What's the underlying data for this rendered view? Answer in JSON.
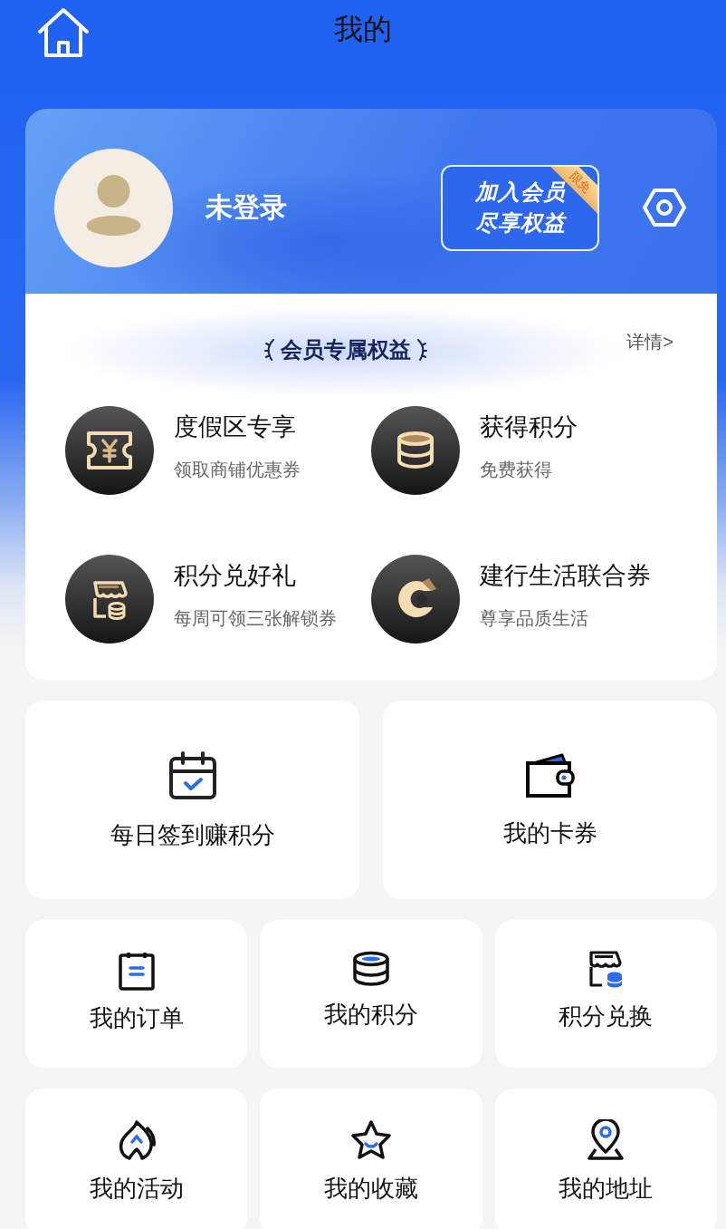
{
  "header": {
    "title": "我的"
  },
  "profile": {
    "name": "未登录",
    "promo": {
      "line1": "加入会员",
      "line2": "尽享权益",
      "tag": "限免"
    }
  },
  "benefits": {
    "title": "会员专属权益",
    "link": "详情>",
    "items": [
      {
        "title": "度假区专享",
        "subtitle": "领取商铺优惠券"
      },
      {
        "title": "获得积分",
        "subtitle": "免费获得"
      },
      {
        "title": "积分兑好礼",
        "subtitle": "每周可领三张解锁券"
      },
      {
        "title": "建行生活联合券",
        "subtitle": "尊享品质生活"
      }
    ]
  },
  "features": [
    {
      "label": "每日签到赚积分"
    },
    {
      "label": "我的卡券"
    }
  ],
  "shortcuts": [
    {
      "label": "我的订单"
    },
    {
      "label": "我的积分"
    },
    {
      "label": "积分兑换"
    },
    {
      "label": "我的活动"
    },
    {
      "label": "我的收藏"
    },
    {
      "label": "我的地址"
    }
  ]
}
